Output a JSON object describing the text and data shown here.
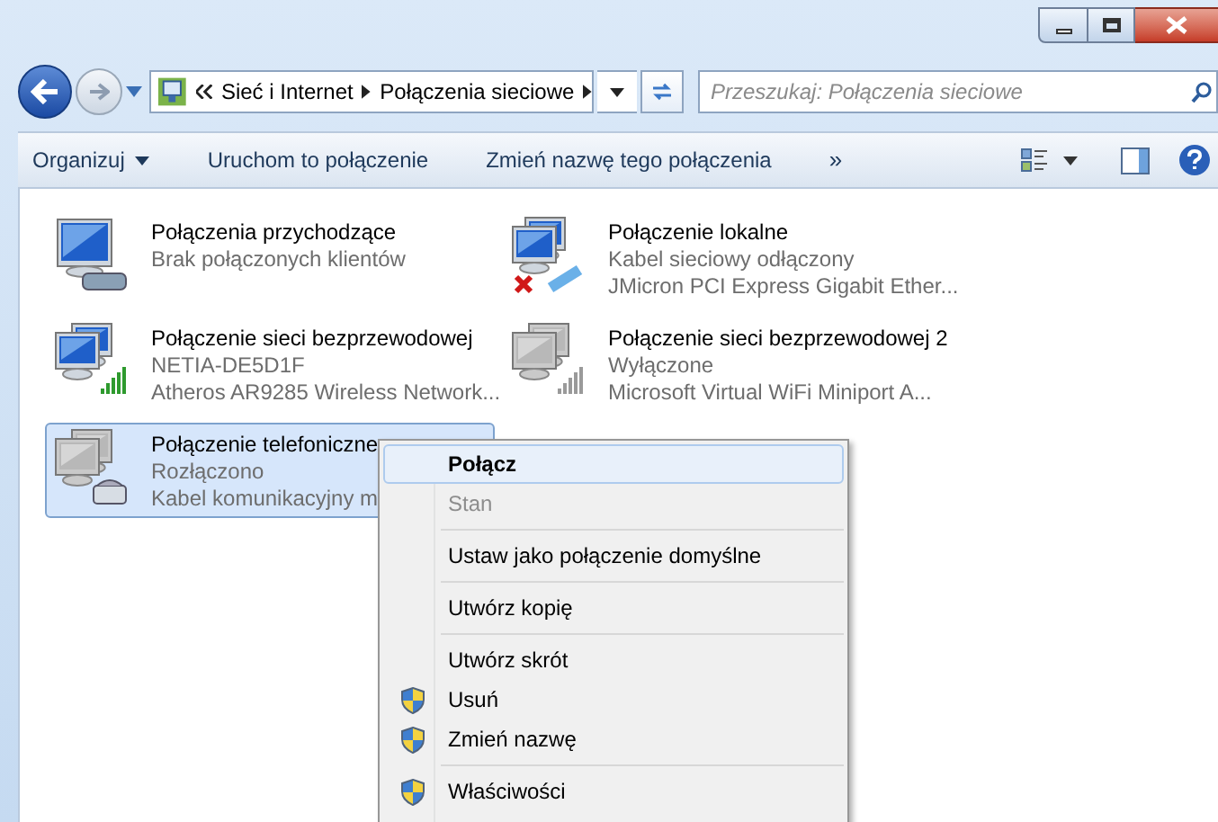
{
  "address_bar": {
    "crumbs": [
      "Sieć i Internet",
      "Połączenia sieciowe"
    ]
  },
  "search": {
    "placeholder": "Przeszukaj: Połączenia sieciowe"
  },
  "toolbar": {
    "items": [
      {
        "label": "Organizuj",
        "dropdown": true
      },
      {
        "label": "Uruchom to połączenie",
        "dropdown": false
      },
      {
        "label": "Zmień nazwę tego połączenia",
        "dropdown": false
      }
    ],
    "more": "»"
  },
  "connections": [
    {
      "kind": "incoming",
      "name": "Połączenia przychodzące",
      "lines": [
        "Brak połączonych klientów"
      ],
      "disabled": false,
      "error": false,
      "selected": false
    },
    {
      "kind": "lan",
      "name": "Połączenie lokalne",
      "lines": [
        "Kabel sieciowy odłączony",
        "JMicron PCI Express Gigabit Ether..."
      ],
      "disabled": false,
      "error": true,
      "selected": false
    },
    {
      "kind": "wifi",
      "name": "Połączenie sieci bezprzewodowej",
      "lines": [
        "NETIA-DE5D1F",
        "Atheros AR9285 Wireless Network..."
      ],
      "disabled": false,
      "error": false,
      "selected": false
    },
    {
      "kind": "wifi",
      "name": "Połączenie sieci bezprzewodowej 2",
      "lines": [
        "Wyłączone",
        "Microsoft Virtual WiFi Miniport A..."
      ],
      "disabled": true,
      "error": false,
      "selected": false
    },
    {
      "kind": "dialup",
      "name": "Połączenie telefoniczne",
      "lines": [
        "Rozłączono",
        "Kabel komunikacyjny m"
      ],
      "disabled": true,
      "error": false,
      "selected": true
    }
  ],
  "context_menu": [
    {
      "kind": "item",
      "label": "Połącz",
      "default": true,
      "selected": true,
      "disabled": false,
      "shield": false
    },
    {
      "kind": "item",
      "label": "Stan",
      "default": false,
      "selected": false,
      "disabled": true,
      "shield": false
    },
    {
      "kind": "separator"
    },
    {
      "kind": "item",
      "label": "Ustaw jako połączenie domyślne",
      "default": false,
      "selected": false,
      "disabled": false,
      "shield": false
    },
    {
      "kind": "separator"
    },
    {
      "kind": "item",
      "label": "Utwórz kopię",
      "default": false,
      "selected": false,
      "disabled": false,
      "shield": false
    },
    {
      "kind": "separator"
    },
    {
      "kind": "item",
      "label": "Utwórz skrót",
      "default": false,
      "selected": false,
      "disabled": false,
      "shield": false
    },
    {
      "kind": "item",
      "label": "Usuń",
      "default": false,
      "selected": false,
      "disabled": false,
      "shield": true
    },
    {
      "kind": "item",
      "label": "Zmień nazwę",
      "default": false,
      "selected": false,
      "disabled": false,
      "shield": true
    },
    {
      "kind": "separator"
    },
    {
      "kind": "item",
      "label": "Właściwości",
      "default": false,
      "selected": false,
      "disabled": false,
      "shield": true
    }
  ]
}
